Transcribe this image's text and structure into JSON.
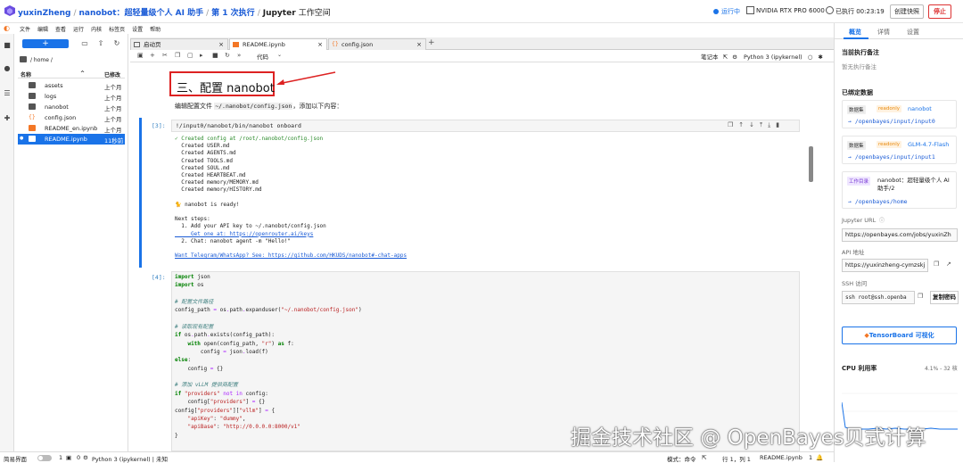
{
  "topbar": {
    "user": "yuxinZheng",
    "project": "nanobot：超轻量级个人 AI 助手",
    "run": "第 1 次执行",
    "app": "Jupyter",
    "app_suffix": "工作空间",
    "status": "运行中",
    "gpu": "NVIDIA RTX PRO 6000",
    "timer": "已执行 00:23:19",
    "snapshot_button": "创建快照",
    "stop_button": "停止"
  },
  "menu": [
    "文件",
    "编辑",
    "查看",
    "运行",
    "内核",
    "标签页",
    "设置",
    "帮助"
  ],
  "filebrowser": {
    "new_button": "+",
    "path": "/ home /",
    "col_name": "名称",
    "col_modified": "已修改",
    "items": [
      {
        "name": "assets",
        "modified": "上个月",
        "type": "folder"
      },
      {
        "name": "logs",
        "modified": "上个月",
        "type": "folder"
      },
      {
        "name": "nanobot",
        "modified": "上个月",
        "type": "folder"
      },
      {
        "name": "config.json",
        "modified": "上个月",
        "type": "json"
      },
      {
        "name": "README_en.ipynb",
        "modified": "上个月",
        "type": "notebook"
      },
      {
        "name": "README.ipynb",
        "modified": "11秒前",
        "type": "notebook"
      }
    ]
  },
  "tabs": [
    {
      "label": "启动页"
    },
    {
      "label": "README.ipynb"
    },
    {
      "label": "config.json"
    }
  ],
  "toolbar": {
    "cell_type": "代码",
    "notebook_label": "笔记本",
    "kernel": "Python 3 (ipykernel)"
  },
  "notebook": {
    "heading": "三、配置 nanobot",
    "md_text_before": "编辑配置文件",
    "md_code": "~/.nanobot/config.json",
    "md_text_after": "，添加以下内容：",
    "cell3_prompt": "[3]:",
    "cell3_code": "!/input0/nanobot/bin/nanobot onboard",
    "cell3_output": [
      "✓ Created config at /root/.nanobot/config.json",
      "  Created USER.md",
      "  Created AGENTS.md",
      "  Created TOOLS.md",
      "  Created SOUL.md",
      "  Created HEARTBEAT.md",
      "  Created memory/MEMORY.md",
      "  Created memory/HISTORY.md",
      "",
      "🐈 nanobot is ready!",
      "",
      "Next steps:",
      "  1. Add your API key to ~/.nanobot/config.json",
      "     Get one at: https://openrouter.ai/keys",
      "  2. Chat: nanobot agent -m \"Hello!\"",
      "",
      "Want Telegram/WhatsApp? See: https://github.com/HKUDS/nanobot#-chat-apps"
    ],
    "cell4_prompt": "[4]:"
  },
  "rightpanel": {
    "tabs": [
      "概览",
      "详情",
      "设置"
    ],
    "note_title": "当前执行备注",
    "note_empty": "暂无执行备注",
    "bound_title": "已绑定数据",
    "datasets": [
      {
        "kind": "数据集",
        "mode": "readonly",
        "name": "nanobot",
        "path": "→ /openbayes/input/input0"
      },
      {
        "kind": "数据集",
        "mode": "readonly",
        "name": "GLM-4.7-Flash",
        "path": "→ /openbayes/input/input1"
      },
      {
        "kind": "工作目录",
        "mode": "",
        "name": "nanobot：超轻量级个人 AI 助手/2",
        "path": "→ /openbayes/home"
      }
    ],
    "jupyter_label": "Jupyter URL",
    "jupyter_url": "https://openbayes.com/jobs/yuxinZh",
    "api_label": "API 地址",
    "api_url": "https://yuxinzheng-cymzskj",
    "ssh_label": "SSH 访问",
    "ssh_cmd": "ssh root@ssh.openba",
    "copy_button": "复制密码",
    "tensorboard_button": "TensorBoard 可视化",
    "cpu_title": "CPU 利用率",
    "cpu_value": "4.1% - 32 核"
  },
  "statusbar": {
    "simple": "简易界面",
    "count1": "1",
    "count2": "0",
    "kernel": "Python 3 (ipykernel) | 未知",
    "mode": "模式：命令",
    "position": "行 1，列 1",
    "file": "README.ipynb",
    "count3": "1"
  },
  "watermark": "掘金技术社区 @ OpenBayes贝式计算",
  "colors": {
    "accent": "#1a73e8",
    "danger": "#dd2222",
    "jupyter_orange": "#f37726"
  }
}
